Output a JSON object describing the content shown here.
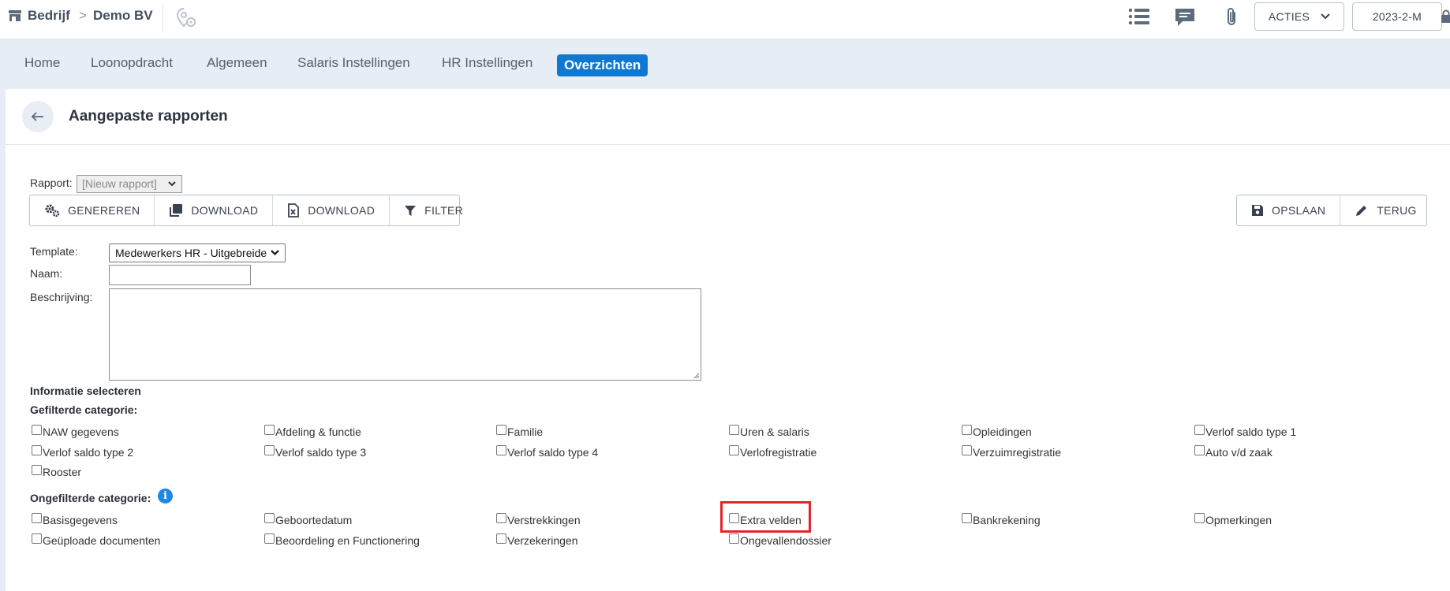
{
  "breadcrumb": {
    "company": "Bedrijf",
    "separator": ">",
    "entity": "Demo BV"
  },
  "header": {
    "actions_label": "ACTIES",
    "period_label": "2023-2-M"
  },
  "nav": {
    "tabs": [
      {
        "label": "Home"
      },
      {
        "label": "Loonopdracht"
      },
      {
        "label": "Algemeen"
      },
      {
        "label": "Salaris Instellingen"
      },
      {
        "label": "HR Instellingen"
      },
      {
        "label": "Overzichten",
        "active": true
      }
    ]
  },
  "page": {
    "title": "Aangepaste rapporten"
  },
  "report": {
    "rapport_label": "Rapport:",
    "rapport_value": "[Nieuw rapport]",
    "toolbar": {
      "generate": "GENEREREN",
      "download1": "DOWNLOAD",
      "download2": "DOWNLOAD",
      "filter": "FILTER",
      "save": "OPSLAAN",
      "back": "TERUG"
    },
    "template_label": "Template:",
    "template_value": "Medewerkers HR - Uitgebreide",
    "naam_label": "Naam:",
    "naam_value": "",
    "beschrijving_label": "Beschrijving:",
    "beschrijving_value": ""
  },
  "info": {
    "heading": "Informatie selecteren",
    "filtered_heading": "Gefilterde categorie:",
    "filtered": [
      "NAW gegevens",
      "Afdeling & functie",
      "Familie",
      "Uren & salaris",
      "Opleidingen",
      "Verlof saldo type 1",
      "Verlof saldo type 2",
      "Verlof saldo type 3",
      "Verlof saldo type 4",
      "Verlofregistratie",
      "Verzuimregistratie",
      "Auto v/d zaak",
      "Rooster"
    ],
    "unfiltered_heading": "Ongefilterde categorie:",
    "unfiltered": [
      "Basisgegevens",
      "Geboortedatum",
      "Verstrekkingen",
      "Extra velden",
      "Bankrekening",
      "Opmerkingen",
      "Geüploade documenten",
      "Beoordeling en Functionering",
      "Verzekeringen",
      "Ongevallendossier"
    ]
  },
  "colors": {
    "accent": "#0f78d1",
    "highlight": "#e3242b",
    "background": "#e6edf4"
  }
}
